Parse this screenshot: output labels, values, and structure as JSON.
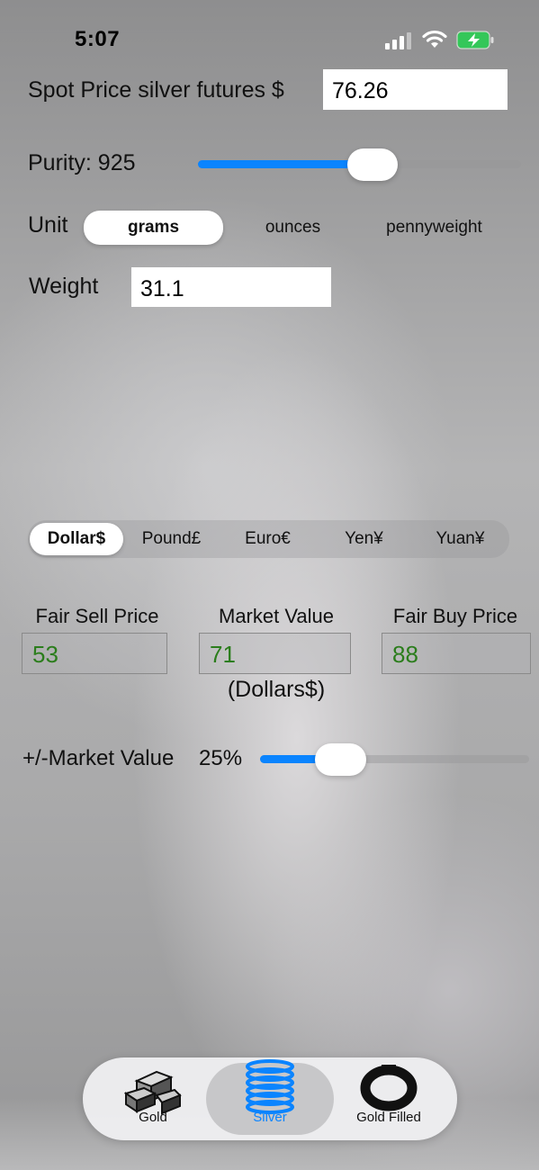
{
  "status_bar": {
    "time": "5:07"
  },
  "spot_price": {
    "label": "Spot Price silver futures $",
    "value": "76.26"
  },
  "purity": {
    "label": "Purity: 925",
    "fraction": 0.54
  },
  "unit": {
    "label": "Unit",
    "options": [
      "grams",
      "ounces",
      "pennyweight"
    ],
    "selected": "grams"
  },
  "weight": {
    "label": "Weight",
    "value": "31.1"
  },
  "currency": {
    "options": [
      "Dollar$",
      "Pound£",
      "Euro€",
      "Yen¥",
      "Yuan¥"
    ],
    "selected": "Dollar$"
  },
  "prices": {
    "fair_sell": {
      "label": "Fair Sell Price",
      "value": "53"
    },
    "market": {
      "label": "Market Value",
      "value": "71"
    },
    "fair_buy": {
      "label": "Fair Buy Price",
      "value": "88"
    },
    "currency_note": "(Dollars$)"
  },
  "market_range": {
    "label": "+/-Market Value",
    "percent_text": "25%",
    "fraction": 0.3
  },
  "tabs": [
    {
      "label": "Gold",
      "icon": "gold-bars-icon"
    },
    {
      "label": "Silver",
      "icon": "silver-coins-icon",
      "active": true
    },
    {
      "label": "Gold Filled",
      "icon": "bracelet-icon"
    }
  ],
  "colors": {
    "accent": "#0a84ff",
    "price_text": "#2b7d1c",
    "battery": "#34c759"
  }
}
